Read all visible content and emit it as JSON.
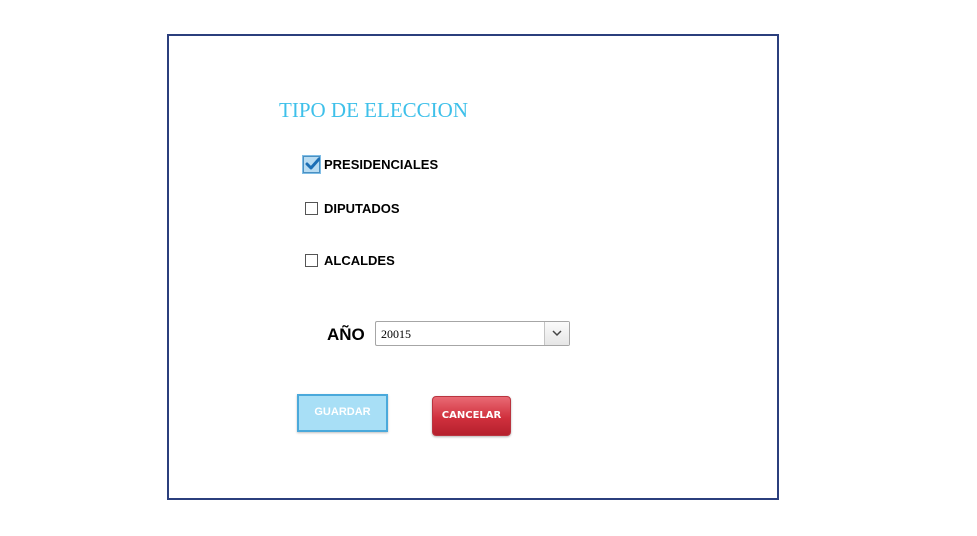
{
  "form": {
    "title": "TIPO DE ELECCION",
    "options": [
      {
        "label": "PRESIDENCIALES",
        "checked": true
      },
      {
        "label": "DIPUTADOS",
        "checked": false
      },
      {
        "label": "ALCALDES",
        "checked": false
      }
    ],
    "year_label": "AÑO",
    "year_value": "20015",
    "save_label": "GUARDAR",
    "cancel_label": "CANCELAR"
  },
  "colors": {
    "title": "#3ec0ea",
    "panel_border": "#2b3f7d",
    "save_bg": "#a8dff6",
    "cancel_bg": "#d0303d"
  },
  "icons": {
    "checkbox_checked": "check-icon",
    "select_arrow": "chevron-down-icon"
  }
}
